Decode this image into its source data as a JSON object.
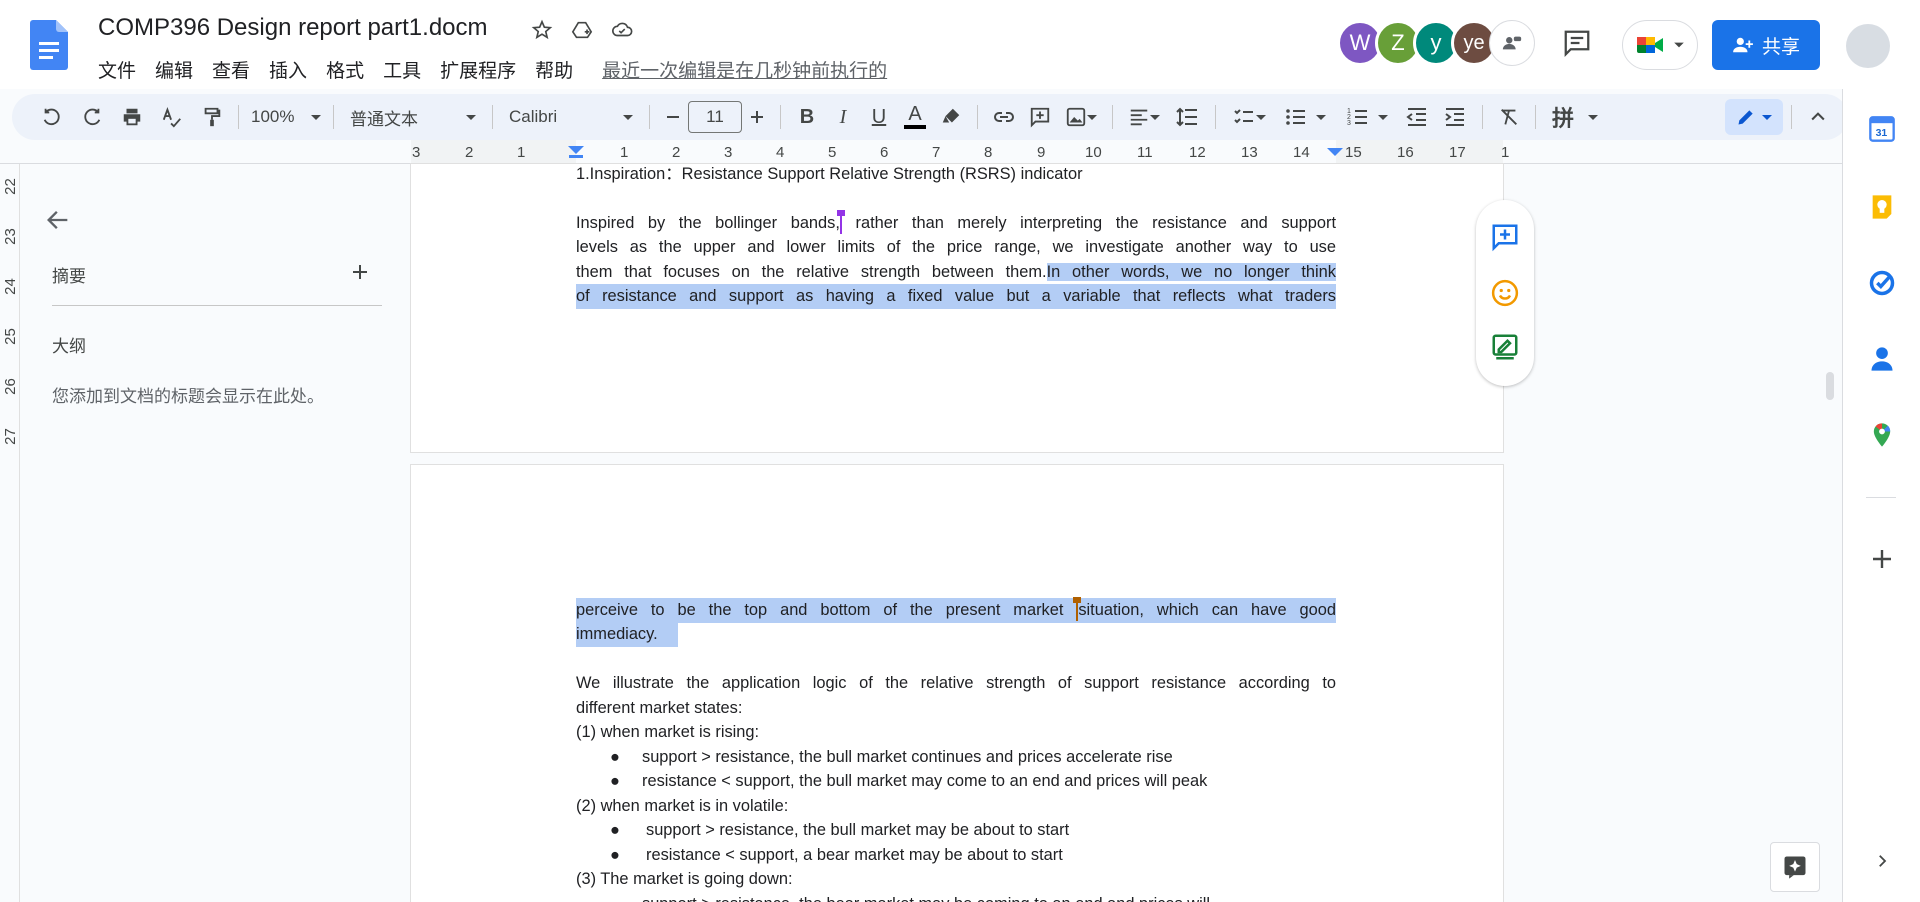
{
  "app": {
    "title": "COMP396 Design report part1.docm",
    "menus": [
      "文件",
      "编辑",
      "查看",
      "插入",
      "格式",
      "工具",
      "扩展程序",
      "帮助"
    ],
    "last_edit": "最近一次编辑是在几秒钟前执行的",
    "share_label": "共享",
    "avatars": [
      {
        "letter": "W",
        "color": "#7e57c2"
      },
      {
        "letter": "Z",
        "color": "#689f38"
      },
      {
        "letter": "y",
        "color": "#00897b"
      },
      {
        "letter": "ye",
        "color": "#6d4c41"
      }
    ]
  },
  "toolbar": {
    "zoom": "100%",
    "style": "普通文本",
    "font": "Calibri",
    "font_size": "11",
    "bold": "B",
    "italic": "I",
    "underline": "U",
    "text_color": "A",
    "input_tool": "拼"
  },
  "ruler": {
    "numbers": [
      "3",
      "2",
      "1",
      "1",
      "2",
      "3",
      "4",
      "5",
      "6",
      "7",
      "8",
      "9",
      "10",
      "11",
      "12",
      "13",
      "14",
      "15",
      "16",
      "17",
      "1"
    ],
    "vertical": [
      "22",
      "23",
      "24",
      "25",
      "26",
      "27"
    ]
  },
  "outline": {
    "summary_label": "摘要",
    "outline_label": "大纲",
    "placeholder": "您添加到文档的标题会显示在此处。"
  },
  "doc": {
    "heading": "1.Inspiration：Resistance Support Relative Strength (RSRS) indicator",
    "p1_l1_a": "Inspired by the bollinger bands,",
    "p1_l1_b": " rather than merely interpreting the resistance and support",
    "p1_l2": "levels as the upper and lower limits of the price range, we investigate another way to use",
    "p1_l3_a": "them that focuses on the relative strength between them.",
    "p1_l3_b": "In other words, we no longer think",
    "p1_l4": "of resistance and support as having a fixed value but a variable that reflects what traders",
    "p2_l1_a": "perceive to be the top and bottom of the present market ",
    "p2_l1_b": "situation, which can have good",
    "p2_l2": "immediacy. ",
    "p3_l1": "We illustrate the application logic of the relative strength of support resistance according to",
    "p3_l2": "different market states:",
    "s1": "(1) when market is rising:",
    "s1_b1": "support > resistance, the bull market continues and prices accelerate rise",
    "s1_b2": "resistance < support, the bull market may come to an end and prices will peak",
    "s2": "(2) when market is in volatile:",
    "s2_b1": "support > resistance, the bull market may be about to start",
    "s2_b2": "resistance < support, a bear market may be about to start",
    "s3": "(3) The market is going down:",
    "s3_b1": "support > resistance, the bear market may be coming to an end and prices will",
    "bullet": "●"
  },
  "colors": {
    "accent": "#1a73e8",
    "selection": "#b3cdf5",
    "cursor_purple": "#9334e6",
    "cursor_orange": "#b06000"
  }
}
